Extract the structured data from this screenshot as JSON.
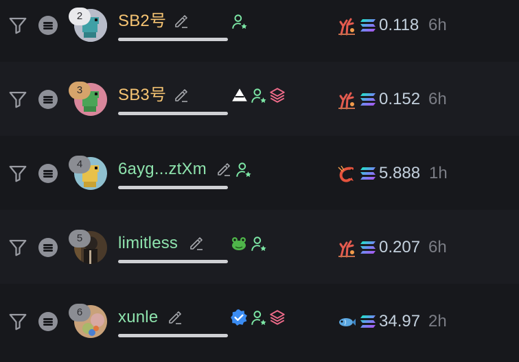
{
  "colors": {
    "background": "#17181c",
    "alt_row": "#1b1c21",
    "name_orange": "#f7c573",
    "name_green": "#8ee3ad",
    "amount_text": "#c3d0dd",
    "age_text": "#7b7d85",
    "follow_icon": "#7de8a6",
    "layers_icon": "#f06b8a",
    "verified_badge": "#3b8cf2"
  },
  "rows": [
    {
      "rank": "2",
      "name": "SB2号",
      "tags": [
        "user-star-icon"
      ],
      "emoji_icon": "coral-icon",
      "token_icon": "solana-icon",
      "amount": "0.118",
      "age": "6h"
    },
    {
      "rank": "3",
      "name": "SB3号",
      "tags": [
        "triangle-icon",
        "user-star-icon",
        "layers-icon"
      ],
      "emoji_icon": "coral-icon",
      "token_icon": "solana-icon",
      "amount": "0.152",
      "age": "6h"
    },
    {
      "rank": "4",
      "name": "6ayg...ztXm",
      "tags": [
        "user-star-icon"
      ],
      "emoji_icon": "shrimp-icon",
      "token_icon": "solana-icon",
      "amount": "5.888",
      "age": "1h"
    },
    {
      "rank": "5",
      "name": "limitless",
      "tags": [
        "frog-icon",
        "user-star-icon"
      ],
      "emoji_icon": "coral-icon",
      "token_icon": "solana-icon",
      "amount": "0.207",
      "age": "6h"
    },
    {
      "rank": "6",
      "name": "xunle",
      "tags": [
        "verified-badge-icon",
        "user-star-icon",
        "layers-icon"
      ],
      "emoji_icon": "fish-icon",
      "token_icon": "solana-icon",
      "amount": "34.97",
      "age": "2h"
    }
  ]
}
